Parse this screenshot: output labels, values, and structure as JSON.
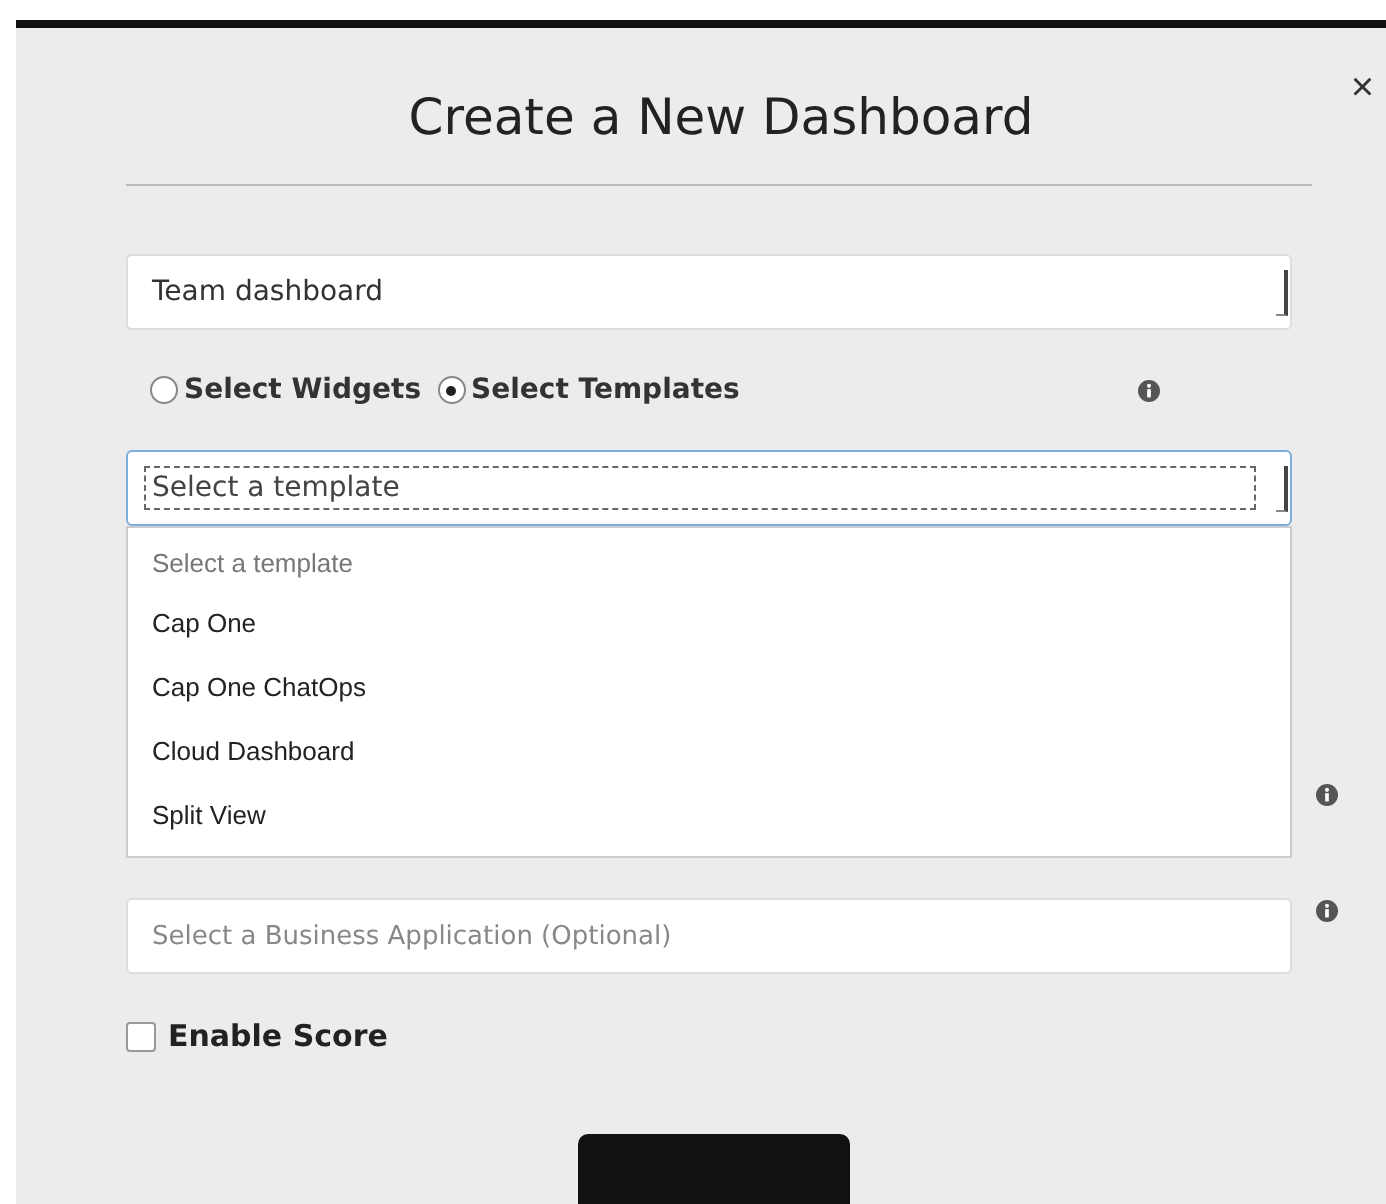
{
  "dialog": {
    "title": "Create a New Dashboard",
    "close": "×"
  },
  "type_select": {
    "value": "Team dashboard"
  },
  "mode_options": [
    {
      "label": "Select Widgets",
      "selected": false
    },
    {
      "label": "Select Templates",
      "selected": true
    }
  ],
  "template_select": {
    "value": "Select a template",
    "expanded": true,
    "options": [
      {
        "label": "Select a template",
        "kind": "placeholder"
      },
      {
        "label": "Cap One",
        "kind": "option"
      },
      {
        "label": "Cap One ChatOps",
        "kind": "option"
      },
      {
        "label": "Cloud Dashboard",
        "kind": "option"
      },
      {
        "label": "Split View",
        "kind": "option"
      }
    ]
  },
  "business_app": {
    "placeholder": "Select a Business Application (Optional)"
  },
  "enable_score": {
    "label": "Enable Score",
    "checked": false
  }
}
